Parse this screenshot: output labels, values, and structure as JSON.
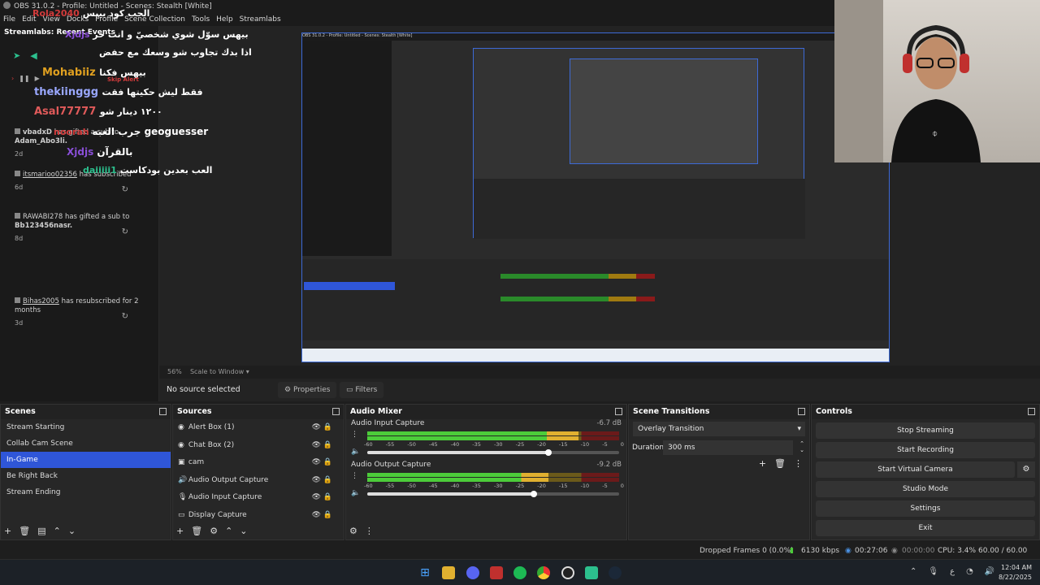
{
  "window": {
    "title": "OBS 31.0.2 - Profile: Untitled - Scenes: Stealth [White]"
  },
  "menu": [
    "File",
    "Edit",
    "View",
    "Docks",
    "Profile",
    "Scene Collection",
    "Tools",
    "Help",
    "Streamlabs"
  ],
  "streamlabs": {
    "title": "Streamlabs: Recent Events",
    "skip": "Skip Alert",
    "events": [
      {
        "user": "vbadxD",
        "text": "has gifted a sub to",
        "target": "Adam_Abo3li.",
        "ago": "2d"
      },
      {
        "user": "itsmarioo02356",
        "text": "has subscribed",
        "ago": "6d"
      },
      {
        "user": "RAWABI278",
        "text": "has gifted a sub to",
        "target": "Bb123456nasr.",
        "ago": "8d"
      },
      {
        "user": "Bihas2005",
        "text": "has resubscribed for 2 months",
        "ago": "3d"
      }
    ]
  },
  "chat_overlay": [
    {
      "user": "Rola2040",
      "text": "الحب كود بيبس",
      "color": "#d23b3b"
    },
    {
      "user": "Xjdjs",
      "text": "بيهس سوّل شوي شخصيّ و انت حر",
      "color": "#8a4fd8"
    },
    {
      "user": "",
      "text": "اذا بدك تجاوب شو وسعك مع حفض",
      "color": "#ffffff"
    },
    {
      "user": "Mohabiiz",
      "text": "بيهس فكنا",
      "color": "#e0a020"
    },
    {
      "user": "thekiinggg",
      "text": "فقط ليش حكيتها فقت",
      "color": "#9aa8ff"
    },
    {
      "user": "Asal77777",
      "text": "١٢٠٠ دينار شو",
      "color": "#e05a5a"
    },
    {
      "user": "noorah",
      "text": "جرب العبه geoguesser",
      "color": "#d23b3b"
    },
    {
      "user": "Xjdjs",
      "text": "بالقرآن",
      "color": "#8a4fd8"
    },
    {
      "user": "daiiiii1",
      "text": "العب بعدين بودكاست",
      "color": "#2cc08e"
    }
  ],
  "preview": {
    "zoom": "56%",
    "scale_label": "Scale to Window"
  },
  "props": {
    "no_source": "No source selected",
    "properties": "Properties",
    "filters": "Filters"
  },
  "scenes": {
    "title": "Scenes",
    "items": [
      "Stream Starting",
      "Collab Cam Scene",
      "In-Game",
      "Be Right Back",
      "Stream Ending"
    ],
    "selected": 2
  },
  "sources": {
    "title": "Sources",
    "items": [
      {
        "label": "Alert Box (1)",
        "icon": "browser-icon"
      },
      {
        "label": "Chat Box (2)",
        "icon": "browser-icon"
      },
      {
        "label": "cam",
        "icon": "camera-icon"
      },
      {
        "label": "Audio Output Capture",
        "icon": "speaker-icon"
      },
      {
        "label": "Audio Input Capture",
        "icon": "mic-icon"
      },
      {
        "label": "Display Capture",
        "icon": "monitor-icon"
      }
    ]
  },
  "mixer": {
    "title": "Audio Mixer",
    "channels": [
      {
        "name": "Audio Input Capture",
        "db": "-6.7 dB",
        "level": 0.84,
        "volume": 0.72
      },
      {
        "name": "Audio Output Capture",
        "db": "-9.2 dB",
        "level": 0.72,
        "volume": 0.66
      }
    ],
    "scale": [
      "-60",
      "-55",
      "-50",
      "-45",
      "-40",
      "-35",
      "-30",
      "-25",
      "-20",
      "-15",
      "-10",
      "-5",
      "0"
    ]
  },
  "transitions": {
    "title": "Scene Transitions",
    "selected": "Overlay Transition",
    "duration_label": "Duration",
    "duration": "300 ms"
  },
  "controls": {
    "title": "Controls",
    "buttons": [
      "Stop Streaming",
      "Start Recording",
      "Start Virtual Camera",
      "Studio Mode",
      "Settings",
      "Exit"
    ]
  },
  "status": {
    "dropped": "Dropped Frames 0 (0.0%)",
    "bitrate": "6130 kbps",
    "stream_time": "00:27:06",
    "rec_time": "00:00:00",
    "cpu": "CPU: 3.4%",
    "fps": "60.00 / 60.00 FPS"
  },
  "taskbar": {
    "time": "12:04 AM",
    "date": "8/22/2025",
    "lang": "ع"
  },
  "colors": {
    "accent": "#2f56d8",
    "meter_green": "#4ccc3a",
    "meter_yellow": "#e0b030",
    "meter_red": "#c83030"
  }
}
